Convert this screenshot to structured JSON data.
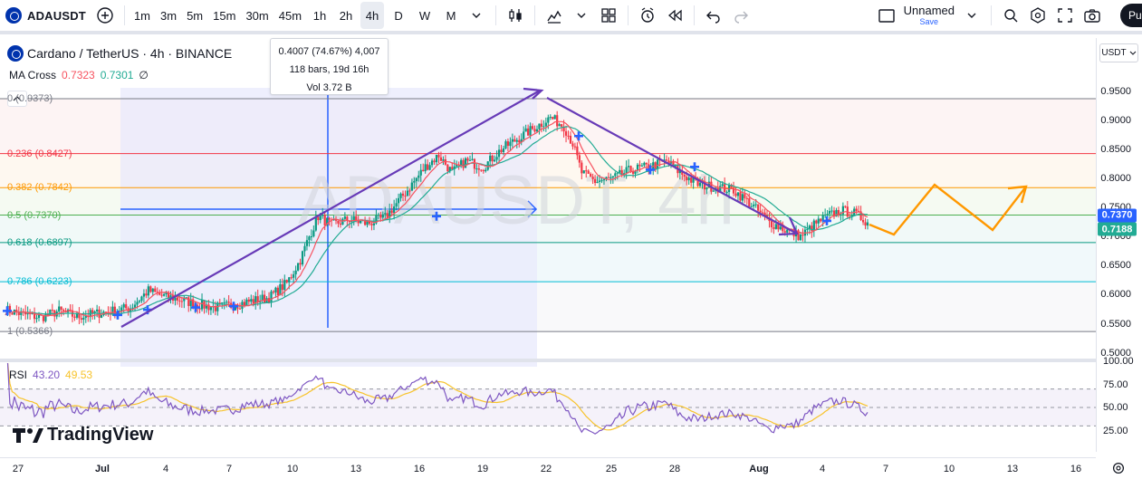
{
  "toolbar": {
    "symbol": "ADAUSDT",
    "intervals": [
      "1m",
      "3m",
      "5m",
      "15m",
      "30m",
      "45m",
      "1h",
      "2h",
      "4h",
      "D",
      "W",
      "M"
    ],
    "active_interval": "4h",
    "layout_name": "Unnamed",
    "layout_save": "Save",
    "publish_label": "Pu"
  },
  "legend": {
    "title": "Cardano / TetherUS · 4h · BINANCE",
    "ma_label": "MA Cross",
    "ma_fast": "0.7323",
    "ma_slow": "0.7301",
    "ma_suffix": "∅"
  },
  "tooltip": {
    "line1": "0.4007 (74.67%) 4,007",
    "line2": "118 bars, 19d 16h",
    "line3": "Vol 3.72 B"
  },
  "watermark": "ADAUSDT, 4h",
  "fib_levels": [
    {
      "label": "0 (0.9373)",
      "price": 0.9373,
      "color": "#787b86"
    },
    {
      "label": "0.236 (0.8427)",
      "price": 0.8427,
      "color": "#f23645"
    },
    {
      "label": "0.382 (0.7842)",
      "price": 0.7842,
      "color": "#ff9800"
    },
    {
      "label": "0.5 (0.7370)",
      "price": 0.737,
      "color": "#4caf50"
    },
    {
      "label": "0.618 (0.6897)",
      "price": 0.6897,
      "color": "#089981"
    },
    {
      "label": "0.786 (0.6223)",
      "price": 0.6223,
      "color": "#00bcd4"
    },
    {
      "label": "1 (0.5366)",
      "price": 0.5366,
      "color": "#787b86"
    }
  ],
  "price_scale": {
    "currency": "USDT",
    "ticks": [
      "0.9500",
      "0.9000",
      "0.8500",
      "0.8000",
      "0.7500",
      "0.7000",
      "0.6500",
      "0.6000",
      "0.5500",
      "0.5000"
    ],
    "last_price": "0.7370",
    "last_price_color": "#2962ff",
    "ma_price": "0.7188",
    "ma_price_color": "#22ab94"
  },
  "rsi": {
    "label": "RSI",
    "value": "43.20",
    "value_color": "#7e57c2",
    "ma_value": "49.53",
    "ma_color": "#f7c32b",
    "ticks": [
      "100.00",
      "75.00",
      "50.00",
      "25.00"
    ]
  },
  "time_axis": {
    "labels": [
      "27",
      "Jul",
      "4",
      "7",
      "10",
      "13",
      "16",
      "19",
      "22",
      "25",
      "28",
      "Aug",
      "4",
      "7",
      "10",
      "13",
      "16"
    ],
    "bold": [
      "Jul",
      "Aug"
    ]
  },
  "brand": "TradingView",
  "chart_data": {
    "type": "candlestick",
    "symbol": "ADAUSDT",
    "interval": "4h",
    "exchange": "BINANCE",
    "y_range": [
      0.49,
      0.97
    ],
    "candle_close_path": [
      [
        0,
        0.574
      ],
      [
        8,
        0.566
      ],
      [
        16,
        0.561
      ],
      [
        24,
        0.572
      ],
      [
        32,
        0.562
      ],
      [
        40,
        0.567
      ],
      [
        48,
        0.572
      ],
      [
        56,
        0.578
      ],
      [
        64,
        0.607
      ],
      [
        70,
        0.598
      ],
      [
        78,
        0.592
      ],
      [
        86,
        0.583
      ],
      [
        94,
        0.578
      ],
      [
        102,
        0.582
      ],
      [
        110,
        0.589
      ],
      [
        118,
        0.595
      ],
      [
        126,
        0.62
      ],
      [
        132,
        0.66
      ],
      [
        136,
        0.7
      ],
      [
        140,
        0.735
      ],
      [
        146,
        0.72
      ],
      [
        154,
        0.73
      ],
      [
        162,
        0.722
      ],
      [
        170,
        0.733
      ],
      [
        180,
        0.78
      ],
      [
        188,
        0.82
      ],
      [
        194,
        0.84
      ],
      [
        200,
        0.81
      ],
      [
        206,
        0.83
      ],
      [
        214,
        0.82
      ],
      [
        222,
        0.85
      ],
      [
        230,
        0.87
      ],
      [
        238,
        0.89
      ],
      [
        244,
        0.905
      ],
      [
        250,
        0.89
      ],
      [
        254,
        0.86
      ],
      [
        258,
        0.81
      ],
      [
        264,
        0.795
      ],
      [
        272,
        0.8
      ],
      [
        280,
        0.815
      ],
      [
        288,
        0.82
      ],
      [
        296,
        0.83
      ],
      [
        302,
        0.81
      ],
      [
        310,
        0.79
      ],
      [
        318,
        0.785
      ],
      [
        326,
        0.78
      ],
      [
        334,
        0.755
      ],
      [
        342,
        0.725
      ],
      [
        350,
        0.71
      ],
      [
        356,
        0.7
      ],
      [
        362,
        0.72
      ],
      [
        368,
        0.735
      ],
      [
        374,
        0.745
      ],
      [
        380,
        0.74
      ],
      [
        386,
        0.725
      ]
    ],
    "ma_fast_color": "#f7525f",
    "ma_slow_color": "#22ab94",
    "rsi_series_color": "#7e57c2",
    "rsi_ma_color": "#f7c32b",
    "rsi_range": [
      0,
      100
    ]
  }
}
